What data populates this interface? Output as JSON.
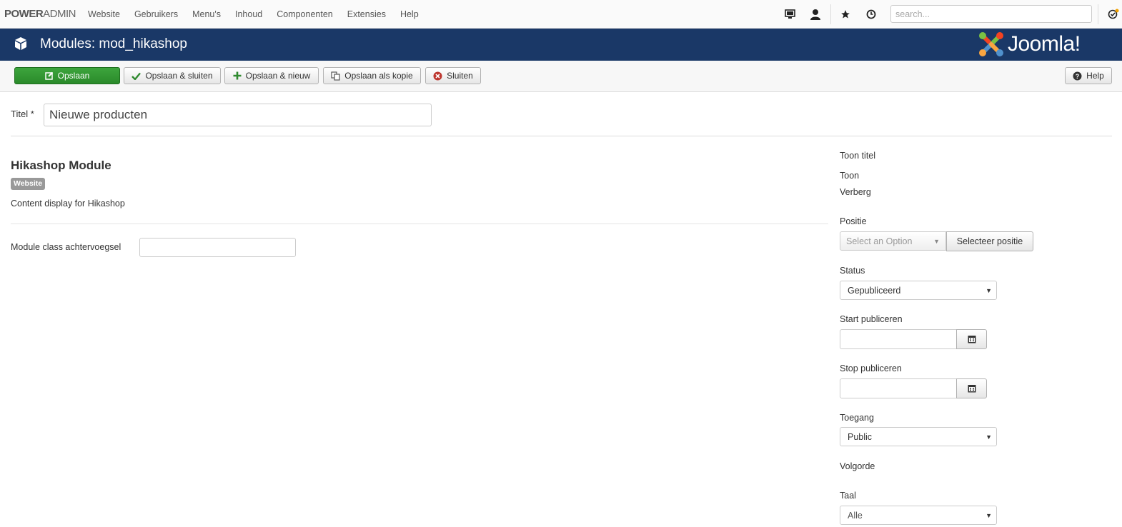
{
  "topbar": {
    "brand_part1": "POWER",
    "brand_part2": "ADMIN",
    "menu": [
      "Website",
      "Gebruikers",
      "Menu's",
      "Inhoud",
      "Componenten",
      "Extensies",
      "Help"
    ],
    "icons": [
      "monitor-icon",
      "user-icon",
      "star-icon",
      "clock-icon",
      "check-circle-icon"
    ],
    "search_placeholder": "search..."
  },
  "header": {
    "title": "Modules: mod_hikashop",
    "logo_text": "Joomla!",
    "color": "#1a3867"
  },
  "toolbar": {
    "save": "Opslaan",
    "save_close": "Opslaan & sluiten",
    "save_new": "Opslaan & nieuw",
    "save_copy": "Opslaan als kopie",
    "close": "Sluiten",
    "help": "Help"
  },
  "form": {
    "title_label": "Titel *",
    "title_value": "Nieuwe producten",
    "module_heading": "Hikashop Module",
    "badge": "Website",
    "description": "Content display for Hikashop",
    "suffix_label": "Module class achtervoegsel",
    "suffix_value": ""
  },
  "sidebar": {
    "show_title_label": "Toon titel",
    "show_option": "Toon",
    "hide_option": "Verberg",
    "position_label": "Positie",
    "position_placeholder": "Select an Option",
    "position_button": "Selecteer positie",
    "status_label": "Status",
    "status_value": "Gepubliceerd",
    "start_label": "Start publiceren",
    "stop_label": "Stop publiceren",
    "access_label": "Toegang",
    "access_value": "Public",
    "order_label": "Volgorde",
    "language_label": "Taal",
    "language_value": "Alle"
  }
}
